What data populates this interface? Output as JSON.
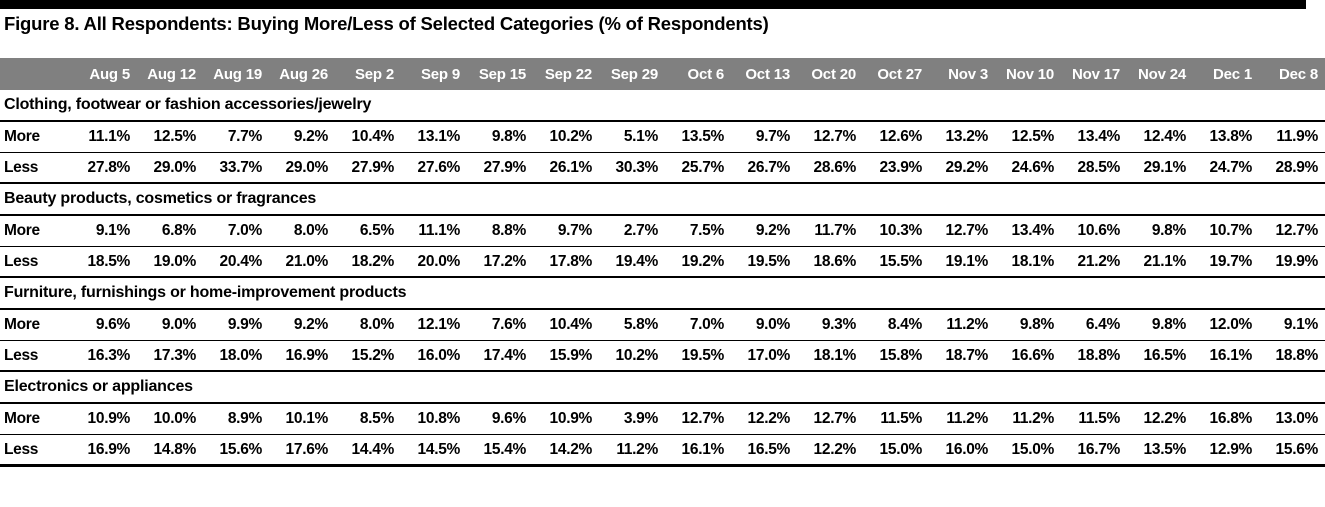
{
  "figure": {
    "title": "Figure 8. All Respondents: Buying More/Less of Selected Categories (% of Respondents)"
  },
  "colors": {
    "header_band": "#808080",
    "header_text": "#ffffff",
    "rule": "#000000",
    "background": "#ffffff"
  },
  "table": {
    "row_label_header": "",
    "columns": [
      "Aug 5",
      "Aug 12",
      "Aug 19",
      "Aug 26",
      "Sep 2",
      "Sep 9",
      "Sep 15",
      "Sep 22",
      "Sep 29",
      "Oct 6",
      "Oct 13",
      "Oct 20",
      "Oct 27",
      "Nov 3",
      "Nov 10",
      "Nov 17",
      "Nov 24",
      "Dec 1",
      "Dec 8"
    ],
    "sections": [
      {
        "label": "Clothing, footwear or fashion accessories/jewelry",
        "rows": [
          {
            "label": "More",
            "values": [
              "11.1%",
              "12.5%",
              "7.7%",
              "9.2%",
              "10.4%",
              "13.1%",
              "9.8%",
              "10.2%",
              "5.1%",
              "13.5%",
              "9.7%",
              "12.7%",
              "12.6%",
              "13.2%",
              "12.5%",
              "13.4%",
              "12.4%",
              "13.8%",
              "11.9%"
            ]
          },
          {
            "label": "Less",
            "values": [
              "27.8%",
              "29.0%",
              "33.7%",
              "29.0%",
              "27.9%",
              "27.6%",
              "27.9%",
              "26.1%",
              "30.3%",
              "25.7%",
              "26.7%",
              "28.6%",
              "23.9%",
              "29.2%",
              "24.6%",
              "28.5%",
              "29.1%",
              "24.7%",
              "28.9%"
            ]
          }
        ]
      },
      {
        "label": "Beauty products, cosmetics or fragrances",
        "rows": [
          {
            "label": "More",
            "values": [
              "9.1%",
              "6.8%",
              "7.0%",
              "8.0%",
              "6.5%",
              "11.1%",
              "8.8%",
              "9.7%",
              "2.7%",
              "7.5%",
              "9.2%",
              "11.7%",
              "10.3%",
              "12.7%",
              "13.4%",
              "10.6%",
              "9.8%",
              "10.7%",
              "12.7%"
            ]
          },
          {
            "label": "Less",
            "values": [
              "18.5%",
              "19.0%",
              "20.4%",
              "21.0%",
              "18.2%",
              "20.0%",
              "17.2%",
              "17.8%",
              "19.4%",
              "19.2%",
              "19.5%",
              "18.6%",
              "15.5%",
              "19.1%",
              "18.1%",
              "21.2%",
              "21.1%",
              "19.7%",
              "19.9%"
            ]
          }
        ]
      },
      {
        "label": "Furniture, furnishings or home-improvement products",
        "rows": [
          {
            "label": "More",
            "values": [
              "9.6%",
              "9.0%",
              "9.9%",
              "9.2%",
              "8.0%",
              "12.1%",
              "7.6%",
              "10.4%",
              "5.8%",
              "7.0%",
              "9.0%",
              "9.3%",
              "8.4%",
              "11.2%",
              "9.8%",
              "6.4%",
              "9.8%",
              "12.0%",
              "9.1%"
            ]
          },
          {
            "label": "Less",
            "values": [
              "16.3%",
              "17.3%",
              "18.0%",
              "16.9%",
              "15.2%",
              "16.0%",
              "17.4%",
              "15.9%",
              "10.2%",
              "19.5%",
              "17.0%",
              "18.1%",
              "15.8%",
              "18.7%",
              "16.6%",
              "18.8%",
              "16.5%",
              "16.1%",
              "18.8%"
            ]
          }
        ]
      },
      {
        "label": "Electronics or appliances",
        "rows": [
          {
            "label": "More",
            "values": [
              "10.9%",
              "10.0%",
              "8.9%",
              "10.1%",
              "8.5%",
              "10.8%",
              "9.6%",
              "10.9%",
              "3.9%",
              "12.7%",
              "12.2%",
              "12.7%",
              "11.5%",
              "11.2%",
              "11.2%",
              "11.5%",
              "12.2%",
              "16.8%",
              "13.0%"
            ]
          },
          {
            "label": "Less",
            "values": [
              "16.9%",
              "14.8%",
              "15.6%",
              "17.6%",
              "14.4%",
              "14.5%",
              "15.4%",
              "14.2%",
              "11.2%",
              "16.1%",
              "16.5%",
              "12.2%",
              "15.0%",
              "16.0%",
              "15.0%",
              "16.7%",
              "13.5%",
              "12.9%",
              "15.6%"
            ]
          }
        ]
      }
    ]
  },
  "chart_data": {
    "type": "table",
    "title": "Figure 8. All Respondents: Buying More/Less of Selected Categories (% of Respondents)",
    "xlabel": "",
    "ylabel": "% of Respondents",
    "categories": [
      "Aug 5",
      "Aug 12",
      "Aug 19",
      "Aug 26",
      "Sep 2",
      "Sep 9",
      "Sep 15",
      "Sep 22",
      "Sep 29",
      "Oct 6",
      "Oct 13",
      "Oct 20",
      "Oct 27",
      "Nov 3",
      "Nov 10",
      "Nov 17",
      "Nov 24",
      "Dec 1",
      "Dec 8"
    ],
    "series": [
      {
        "name": "Clothing, footwear or fashion accessories/jewelry - More",
        "values": [
          11.1,
          12.5,
          7.7,
          9.2,
          10.4,
          13.1,
          9.8,
          10.2,
          5.1,
          13.5,
          9.7,
          12.7,
          12.6,
          13.2,
          12.5,
          13.4,
          12.4,
          13.8,
          11.9
        ]
      },
      {
        "name": "Clothing, footwear or fashion accessories/jewelry - Less",
        "values": [
          27.8,
          29.0,
          33.7,
          29.0,
          27.9,
          27.6,
          27.9,
          26.1,
          30.3,
          25.7,
          26.7,
          28.6,
          23.9,
          29.2,
          24.6,
          28.5,
          29.1,
          24.7,
          28.9
        ]
      },
      {
        "name": "Beauty products, cosmetics or fragrances - More",
        "values": [
          9.1,
          6.8,
          7.0,
          8.0,
          6.5,
          11.1,
          8.8,
          9.7,
          2.7,
          7.5,
          9.2,
          11.7,
          10.3,
          12.7,
          13.4,
          10.6,
          9.8,
          10.7,
          12.7
        ]
      },
      {
        "name": "Beauty products, cosmetics or fragrances - Less",
        "values": [
          18.5,
          19.0,
          20.4,
          21.0,
          18.2,
          20.0,
          17.2,
          17.8,
          19.4,
          19.2,
          19.5,
          18.6,
          15.5,
          19.1,
          18.1,
          21.2,
          21.1,
          19.7,
          19.9
        ]
      },
      {
        "name": "Furniture, furnishings or home-improvement products - More",
        "values": [
          9.6,
          9.0,
          9.9,
          9.2,
          8.0,
          12.1,
          7.6,
          10.4,
          5.8,
          7.0,
          9.0,
          9.3,
          8.4,
          11.2,
          9.8,
          6.4,
          9.8,
          12.0,
          9.1
        ]
      },
      {
        "name": "Furniture, furnishings or home-improvement products - Less",
        "values": [
          16.3,
          17.3,
          18.0,
          16.9,
          15.2,
          16.0,
          17.4,
          15.9,
          10.2,
          19.5,
          17.0,
          18.1,
          15.8,
          18.7,
          16.6,
          18.8,
          16.5,
          16.1,
          18.8
        ]
      },
      {
        "name": "Electronics or appliances - More",
        "values": [
          10.9,
          10.0,
          8.9,
          10.1,
          8.5,
          10.8,
          9.6,
          10.9,
          3.9,
          12.7,
          12.2,
          12.7,
          11.5,
          11.2,
          11.2,
          11.5,
          12.2,
          16.8,
          13.0
        ]
      },
      {
        "name": "Electronics or appliances - Less",
        "values": [
          16.9,
          14.8,
          15.6,
          17.6,
          14.4,
          14.5,
          15.4,
          14.2,
          11.2,
          16.1,
          16.5,
          12.2,
          15.0,
          16.0,
          15.0,
          16.7,
          13.5,
          12.9,
          15.6
        ]
      }
    ],
    "grid": false,
    "legend": "none"
  }
}
